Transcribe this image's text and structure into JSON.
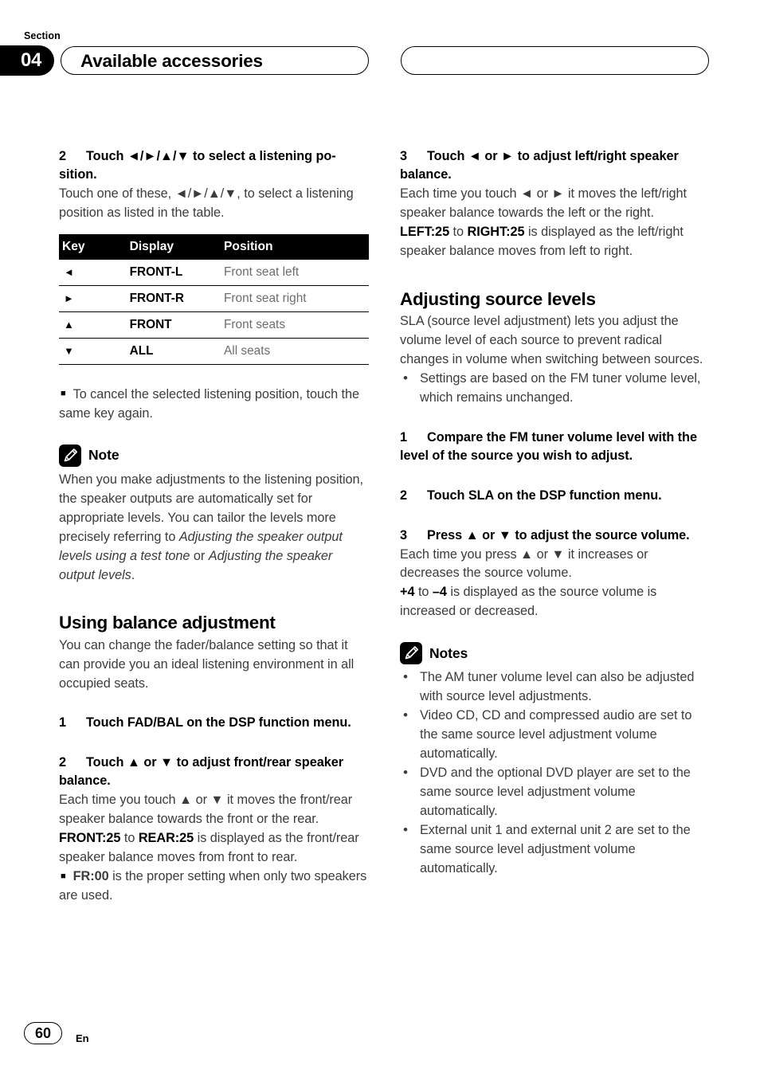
{
  "header": {
    "section_label": "Section",
    "section_number": "04",
    "title": "Available accessories",
    "right_pill_title": ""
  },
  "left_column": {
    "step2": {
      "number": "2",
      "text": "Touch ◄/►/▲/▼ to select a listening po-sition."
    },
    "step2_body": "Touch one of these, ◄/►/▲/▼, to select a listening position as listed in the table.",
    "table": {
      "headers": [
        "Key",
        "Display",
        "Position"
      ],
      "rows": [
        {
          "key": "◄",
          "display": "FRONT-L",
          "position": "Front seat left"
        },
        {
          "key": "►",
          "display": "FRONT-R",
          "position": "Front seat right"
        },
        {
          "key": "▲",
          "display": "FRONT",
          "position": "Front seats"
        },
        {
          "key": "▼",
          "display": "ALL",
          "position": "All seats"
        }
      ]
    },
    "cancel_bullet": "To cancel the selected listening position, touch the same key again.",
    "note": {
      "title": "Note",
      "text_part1": "When you make adjustments to the listening position, the speaker outputs are automatically set for appropriate levels. You can tailor the levels more precisely referring to ",
      "italic1": "Adjusting the speaker output levels using a test tone",
      "text_part2": " or ",
      "italic2": "Adjusting the speaker output levels",
      "text_part3": "."
    },
    "balance_heading": "Using balance adjustment",
    "balance_intro": "You can change the fader/balance setting so that it can provide you an ideal listening environment in all occupied seats.",
    "step1": {
      "number": "1",
      "text": "Touch FAD/BAL on the DSP function menu."
    },
    "step2b": {
      "number": "2",
      "text": "Touch ▲ or ▼ to adjust front/rear speaker balance."
    },
    "step2b_body": "Each time you touch ▲ or ▼ it moves the front/rear speaker balance towards the front or the rear.",
    "range_front": "FRONT:25",
    "range_to": " to ",
    "range_rear": "REAR:25",
    "range_tail": " is displayed as the front/rear speaker balance moves from front to rear.",
    "fr_bullet_bold": "FR:00",
    "fr_bullet_text": " is the proper setting when only two speakers are used."
  },
  "right_column": {
    "step3": {
      "number": "3",
      "text": "Touch ◄ or ► to adjust left/right speaker balance."
    },
    "step3_body": "Each time you touch ◄ or ► it moves the left/right speaker balance towards the left or the right.",
    "range_left": "LEFT:25",
    "range_to": " to ",
    "range_right": "RIGHT:25",
    "range_tail": " is displayed as the left/right speaker balance moves from left to right.",
    "source_heading": "Adjusting source levels",
    "source_intro": "SLA (source level adjustment) lets you adjust the volume level of each source to prevent radical changes in volume when switching between sources.",
    "source_bullets": [
      "Settings are based on the FM tuner volume level, which remains unchanged."
    ],
    "step1": {
      "number": "1",
      "text": "Compare the FM tuner volume level with the level of the source you wish to adjust."
    },
    "step2": {
      "number": "2",
      "text": "Touch SLA on the DSP function menu."
    },
    "step3b": {
      "number": "3",
      "text": "Press ▲ or ▼ to adjust the source volume."
    },
    "step3b_body": "Each time you press ▲ or ▼ it increases or decreases the source volume.",
    "range_plus": "+4",
    "range_to2": " to ",
    "range_minus": "–4",
    "range_tail2": " is displayed as the source volume is increased or decreased.",
    "notes": {
      "title": "Notes",
      "items": [
        "The AM tuner volume level can also be adjusted with source level adjustments.",
        "Video CD, CD and compressed audio are set to the same source level adjustment volume automatically.",
        "DVD and the optional DVD player are set to the same source level adjustment volume automatically.",
        "External unit 1 and external unit 2 are set to the same source level adjustment volume automatically."
      ]
    }
  },
  "footer": {
    "page_number": "60",
    "language": "En"
  }
}
